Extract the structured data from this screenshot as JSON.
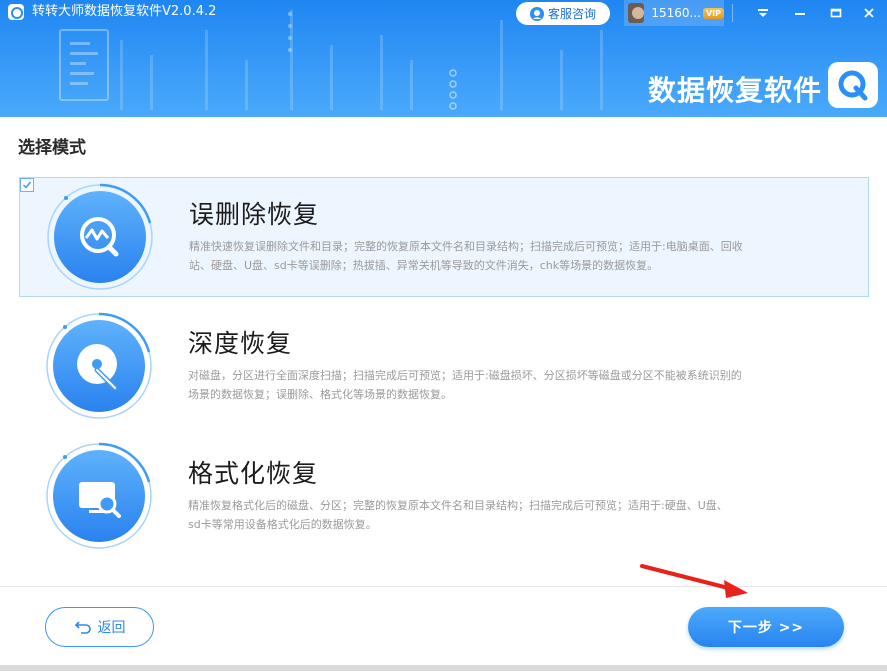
{
  "window": {
    "title": "转转大师数据恢复软件V2.0.4.2",
    "brand_text": "数据恢复软件"
  },
  "header": {
    "service_label": "客服咨询",
    "user_name": "15160...",
    "vip_label": "VIP"
  },
  "section_title": "选择模式",
  "modes": [
    {
      "title": "误删除恢复",
      "desc_line1": "精准快速恢复误删除文件和目录；完整的恢复原本文件名和目录结构；扫描完成后可预览；适用于:电脑桌面、回收",
      "desc_line2": "站、硬盘、U盘、sd卡等误删除；热拔插、异常关机等导致的文件消失，chk等场景的数据恢复。",
      "selected": true,
      "icon": "search-wave-icon"
    },
    {
      "title": "深度恢复",
      "desc_line1": "对磁盘，分区进行全面深度扫描；扫描完成后可预览；适用于:磁盘损坏、分区损坏等磁盘或分区不能被系统识别的",
      "desc_line2": "场景的数据恢复；误删除、格式化等场景的数据恢复。",
      "selected": false,
      "icon": "disk-icon"
    },
    {
      "title": "格式化恢复",
      "desc_line1": "精准恢复格式化后的磁盘、分区；完整的恢复原本文件名和目录结构；扫描完成后可预览；适用于:硬盘、U盘、",
      "desc_line2": "sd卡等常用设备格式化后的数据恢复。",
      "selected": false,
      "icon": "monitor-search-icon"
    }
  ],
  "footer": {
    "back_label": "返回",
    "next_label": "下一步 >>"
  },
  "colors": {
    "accent": "#2684f0",
    "header_top": "#1f86f2",
    "selected_bg": "#edf5fe",
    "annotation_arrow": "#e8221b"
  }
}
